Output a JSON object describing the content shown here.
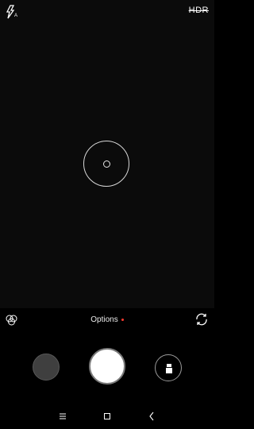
{
  "top_bar": {
    "flash_icon": "flash-auto-icon",
    "hdr_label": "HDR"
  },
  "viewfinder": {
    "focus_icon": "focus-ring-icon"
  },
  "controls": {
    "filter_icon": "filters-icon",
    "options_label": "Options",
    "switch_icon": "switch-camera-icon",
    "mode_icon": "shutter-mode-icon"
  },
  "navbar": {
    "menu_icon": "menu-icon",
    "home_icon": "home-icon",
    "back_icon": "back-icon"
  },
  "colors": {
    "background": "#000000",
    "options_dot": "#ff3b30",
    "shutter": "#ffffff"
  }
}
